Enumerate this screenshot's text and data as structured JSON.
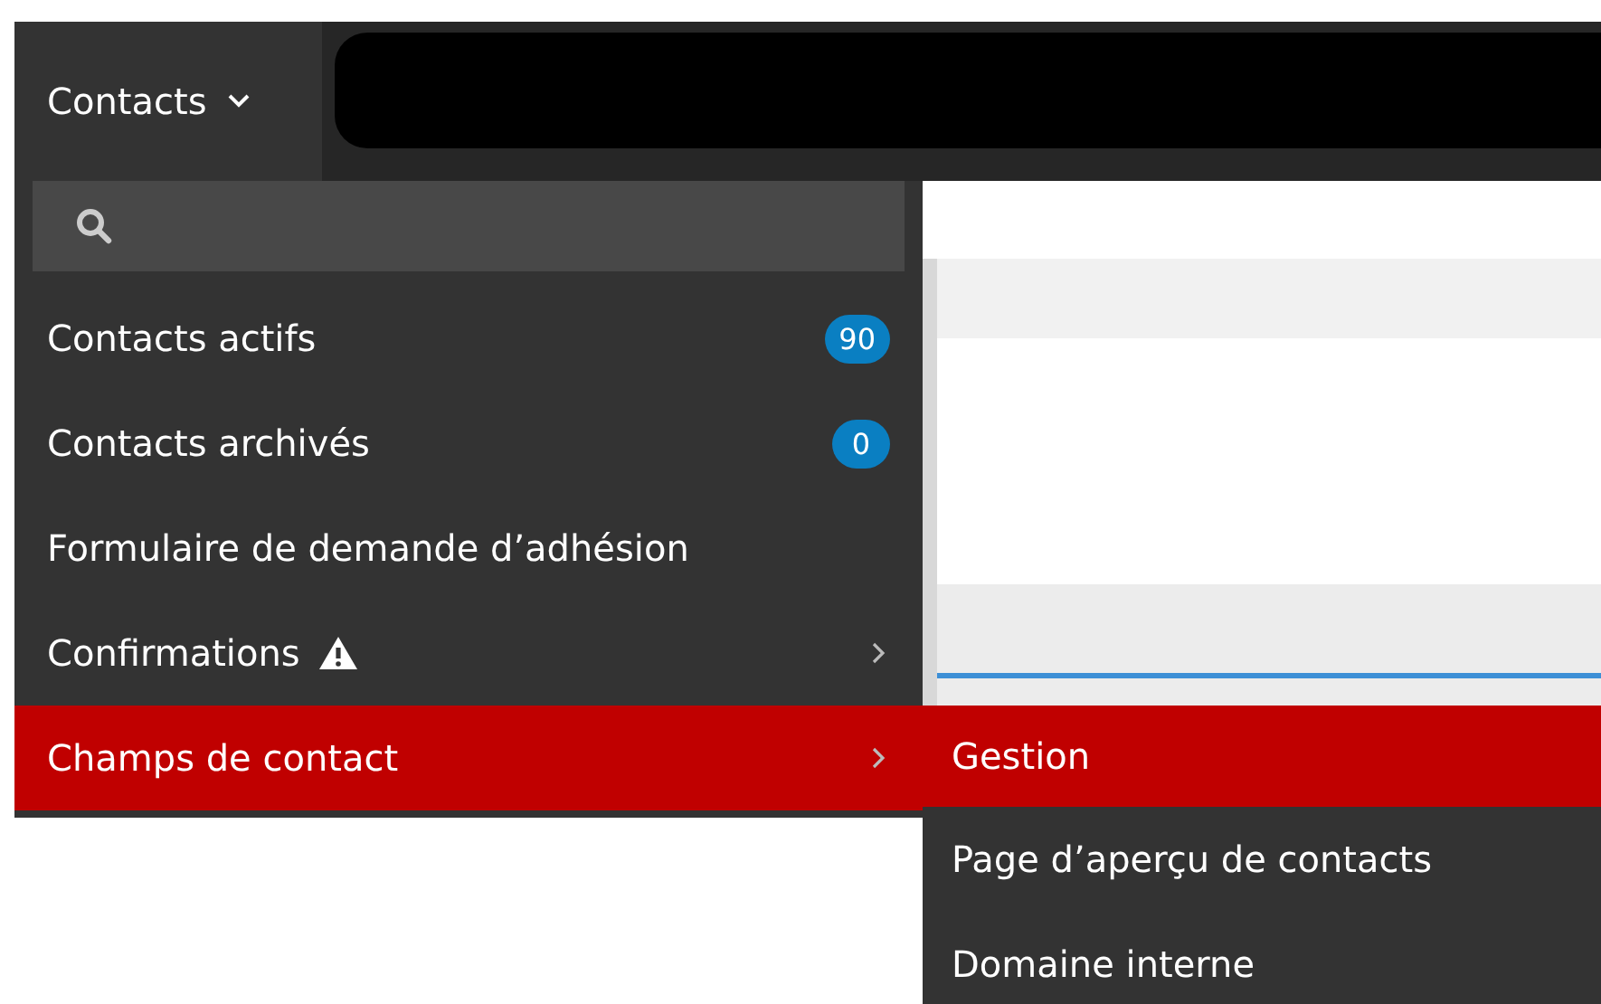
{
  "nav": {
    "label": "Contacts",
    "expanded": true
  },
  "menu": {
    "items": [
      {
        "label": "Contacts actifs",
        "count": "90",
        "warning": false,
        "submenu": false,
        "selected": false
      },
      {
        "label": "Contacts archivés",
        "count": "0",
        "warning": false,
        "submenu": false,
        "selected": false
      },
      {
        "label": "Formulaire de demande d’adhésion",
        "warning": false,
        "submenu": false,
        "selected": false
      },
      {
        "label": "Confirmations",
        "warning": true,
        "submenu": true,
        "selected": false
      },
      {
        "label": "Champs de contact",
        "warning": false,
        "submenu": true,
        "selected": true
      }
    ]
  },
  "submenu": {
    "items": [
      {
        "label": "Gestion",
        "selected": true
      },
      {
        "label": "Page d’aperçu de contacts",
        "selected": false
      },
      {
        "label": "Domaine interne",
        "selected": false
      }
    ]
  }
}
